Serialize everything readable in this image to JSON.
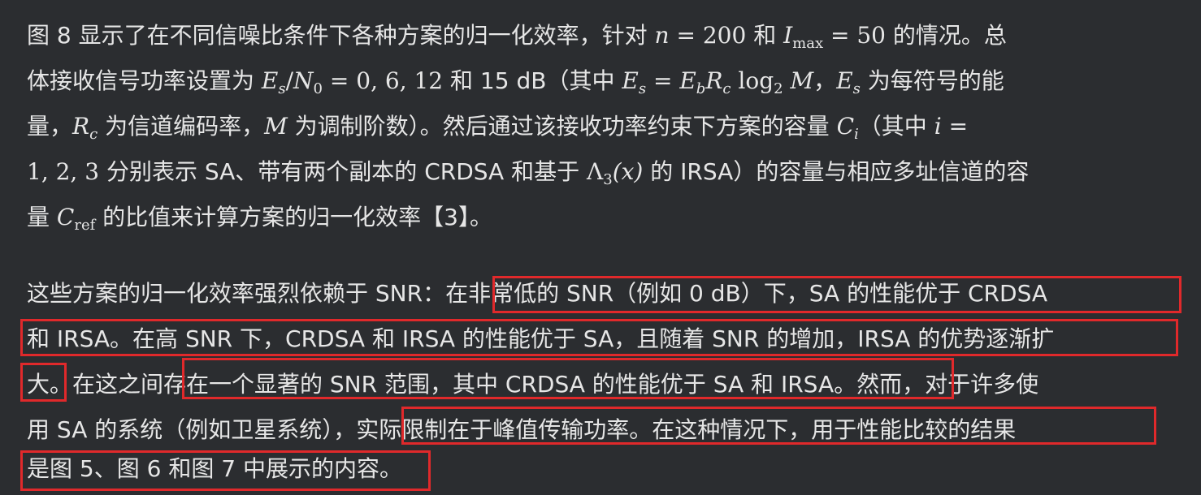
{
  "paragraph1": {
    "l1": {
      "a": "图 8 显示了在不同信噪比条件下各种方案的归一化效率，针对 ",
      "n": "n",
      "eq1": " = 200 ",
      "he": "和 ",
      "I": "I",
      "max": "max",
      "eq2": " = 50 ",
      "tail": "的情况。总"
    },
    "l2": {
      "a": "体接收信号功率设置为 ",
      "Es": "E",
      "s": "s",
      "slash": "/",
      "N": "N",
      "zero": "0",
      "vals": " = 0, 6, 12 ",
      "b": "和 15 dB（其中 ",
      "Es2": "E",
      "s2": "s",
      "eq": " = ",
      "Eb": "E",
      "b_sub": "b",
      "Rc": "R",
      "c": "c",
      "log": " log",
      "two": "2",
      "M": " M",
      "c_tail": "，",
      "Es3": "E",
      "s3": "s",
      "tail": " 为每符号的能"
    },
    "l3": {
      "a": "量，",
      "R": "R",
      "c": "c",
      "b": " 为信道编码率，",
      "M": "M",
      "c_text": " 为调制阶数）。然后通过该接收功率约束下方案的容量 ",
      "C": "C",
      "i": "i",
      "d": "（其中 ",
      "iv": "i",
      "eq": " ="
    },
    "l4": {
      "nums": "1, 2, 3 ",
      "a": "分别表示 SA、带有两个副本的 CRDSA 和基于 ",
      "L": "Λ",
      "three": "3",
      "x": "(x)",
      "b": " 的 IRSA）的容量与相应多址信道的容"
    },
    "l5": {
      "a": "量 ",
      "C": "C",
      "ref": "ref",
      "b": " 的比值来计算方案的归一化效率【3】。"
    }
  },
  "paragraph2": {
    "lines": [
      "这些方案的归一化效率强烈依赖于 SNR：在非常低的 SNR（例如 0 dB）下，SA 的性能优于 CRDSA",
      "和 IRSA。在高 SNR 下，CRDSA 和 IRSA 的性能优于 SA，且随着 SNR 的增加，IRSA 的优势逐渐扩",
      "大。在这之间存在一个显著的 SNR 范围，其中 CRDSA 的性能优于 SA 和 IRSA。然而，对于许多使",
      "用 SA 的系统（例如卫星系统），实际限制在于峰值传输功率。在这种情况下，用于性能比较的结果",
      "是图 5、图 6 和图 7 中展示的内容。"
    ]
  },
  "colors": {
    "background": "#2b2d30",
    "text": "#e6e6e6",
    "highlight": "#e0292b"
  }
}
